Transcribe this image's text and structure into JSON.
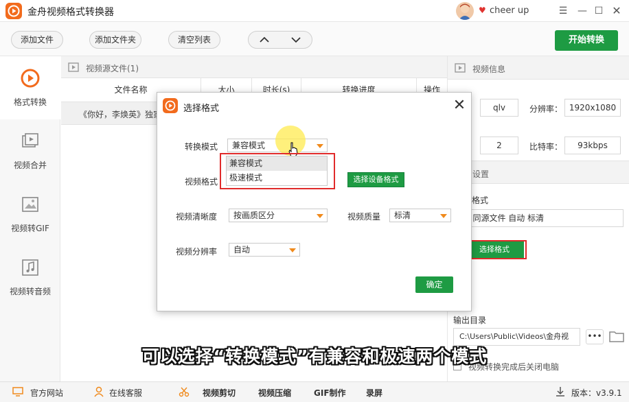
{
  "app": {
    "title": "金舟视频格式转换器",
    "user_name": "cheer up"
  },
  "window": {
    "menu_icon": "menu-icon",
    "minimize_icon": "minimize-icon",
    "maximize_icon": "maximize-icon",
    "close_icon": "close-icon"
  },
  "toolbar": {
    "add_file": "添加文件",
    "add_folder": "添加文件夹",
    "clear_list": "清空列表",
    "move_up": "∧",
    "move_down": "∨",
    "start": "开始转换"
  },
  "sidebar": {
    "items": [
      {
        "label": "格式转换",
        "icon": "play-circle-icon",
        "active": true
      },
      {
        "label": "视频合并",
        "icon": "video-merge-icon",
        "active": false
      },
      {
        "label": "视频转GIF",
        "icon": "image-icon",
        "active": false
      },
      {
        "label": "视频转音频",
        "icon": "music-note-icon",
        "active": false
      }
    ]
  },
  "file_panel": {
    "header": "视频源文件(1)",
    "columns": [
      "文件名称",
      "大小",
      "时长(s)",
      "转换进度",
      "操作"
    ],
    "rows": [
      {
        "name": "《你好，李焕英》独家"
      }
    ]
  },
  "info_panel": {
    "header": "视频信息",
    "format_value": "qlv",
    "resolution_label": "分辨率：",
    "resolution_value": "1920x1080",
    "channels_value": "2",
    "bitrate_label": "比特率：",
    "bitrate_value": "93kbps",
    "settings_header": "设置",
    "output_format_label": "格式",
    "output_format_value": "4 同源文件 自动 标清",
    "select_format_button": "选择格式",
    "output_dir_label": "输出目录",
    "output_dir_value": "C:\\Users\\Public\\Videos\\金舟视",
    "more_button": "•••",
    "shutdown_label": "视频转换完成后关闭电脑"
  },
  "dialog": {
    "title": "选择格式",
    "mode_label": "转换模式",
    "mode_value": "兼容模式",
    "mode_options": [
      "兼容模式",
      "极速模式"
    ],
    "video_format_label": "视频格式",
    "device_button": "选择设备格式",
    "clarity_label": "视频清晰度",
    "clarity_value": "按画质区分",
    "quality_label": "视频质量",
    "quality_value": "标清",
    "resolution_label": "视频分辨率",
    "resolution_value": "自动",
    "ok_button": "确定"
  },
  "subtitle": "可以选择“转换模式”有兼容和极速两个模式",
  "bottombar": {
    "items": [
      "官方网站",
      "在线客服",
      "视频剪切",
      "视频压缩",
      "GIF制作",
      "录屏"
    ],
    "version": "版本：v3.9.1"
  },
  "colors": {
    "accent": "#1e9b43",
    "brand": "#f26b1d",
    "highlight": "#e02a2a"
  }
}
